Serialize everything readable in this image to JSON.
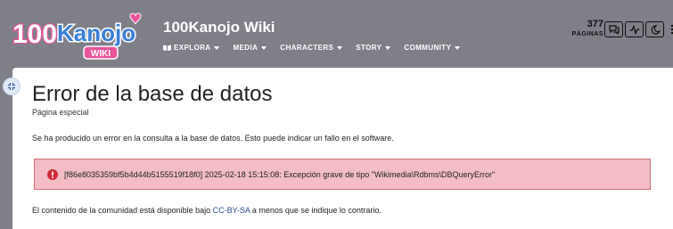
{
  "brand": {
    "logo_main": "100Kanojo",
    "logo_sub": "WIKI",
    "wiki_title": "100Kanojo Wiki"
  },
  "nav": {
    "items": [
      {
        "label": "EXPLORA",
        "icon": "book-icon"
      },
      {
        "label": "MEDIA"
      },
      {
        "label": "CHARACTERS"
      },
      {
        "label": "STORY"
      },
      {
        "label": "COMMUNITY"
      }
    ]
  },
  "stats": {
    "count": "377",
    "count_label": "PÁGINAS"
  },
  "tools": [
    "discussions-icon",
    "activity-icon",
    "dark-mode-icon",
    "more-icon"
  ],
  "page": {
    "title": "Error de la base de datos",
    "subtitle": "Página especial",
    "intro": "Se ha producido un error en la consulta a la base de datos. Esto puede indicar un fallo en el software.",
    "error_message": "[f86e8035359bf5b4d44b5155519f18f0] 2025-02-18 15:15:08: Excepción grave de tipo \"Wikimedia\\Rdbms\\DBQueryError\"",
    "footer_before": "El contenido de la comunidad está disponible bajo ",
    "footer_link": "CC-BY-SA",
    "footer_after": " a menos que se indique lo contrario."
  },
  "colors": {
    "header_bg": "#7f7f88",
    "logo_pink": "#e8559a",
    "logo_blue": "#3a7fd6",
    "error_bg": "#f2bdc4",
    "error_border": "#d0707a",
    "error_icon": "#d32a3a",
    "link": "#2a4b8d"
  }
}
